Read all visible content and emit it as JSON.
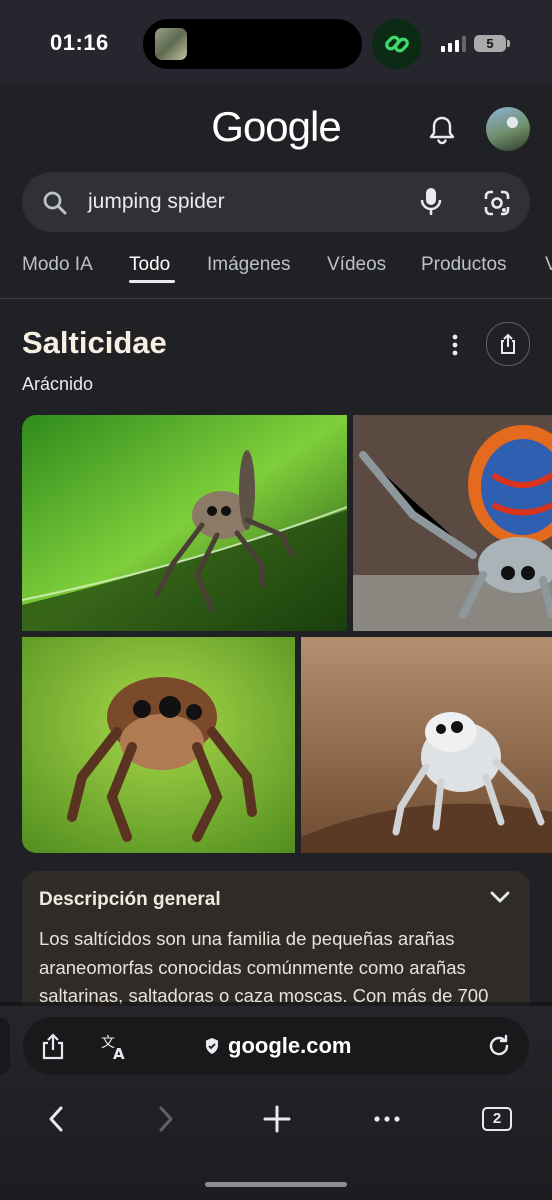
{
  "status_bar": {
    "time": "01:16",
    "battery": "5"
  },
  "header": {
    "logo": "Google"
  },
  "search": {
    "query": "jumping spider"
  },
  "tabs": [
    {
      "label": "Modo IA"
    },
    {
      "label": "Todo"
    },
    {
      "label": "Imágenes"
    },
    {
      "label": "Vídeos"
    },
    {
      "label": "Productos"
    },
    {
      "label": "V"
    }
  ],
  "knowledge_panel": {
    "title": "Salticidae",
    "subtitle": "Arácnido"
  },
  "overview": {
    "title": "Descripción general",
    "text": "Los saltícidos son una familia de pequeñas arañas araneomorfas conocidas comúnmente como arañas saltarinas, saltadoras o caza moscas. Con más de 700"
  },
  "browser": {
    "domain": "google.com",
    "tab_count": "2"
  },
  "colors": {
    "background": "#202124",
    "search_bar": "#303134",
    "overview_card": "#2f2b27",
    "link_badge": "#3ddc6a"
  },
  "icons": [
    "search-icon",
    "mic-icon",
    "lens-icon",
    "bell-icon",
    "more-vert-icon",
    "share-icon",
    "chevron-down-icon",
    "translate-icon",
    "lock-icon",
    "reload-icon",
    "back-icon",
    "forward-icon",
    "plus-icon",
    "more-horiz-icon",
    "tabs-icon"
  ]
}
